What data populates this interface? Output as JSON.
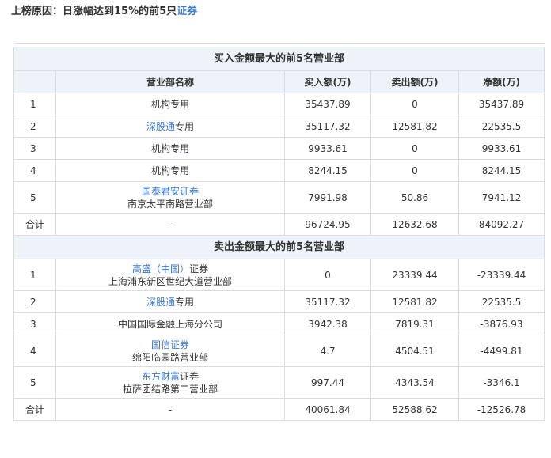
{
  "headline": {
    "prefix": "上榜原因：日涨幅达到15%的前5只",
    "link": "证券"
  },
  "buy_table": {
    "title": "买入金额最大的前5名营业部",
    "headers": [
      "营业部名称",
      "买入额(万)",
      "卖出额(万)",
      "净额(万)"
    ],
    "rows": [
      {
        "idx": "1",
        "link": "",
        "rest": "机构专用",
        "line2": "",
        "buy": "35437.89",
        "sell": "0",
        "net": "35437.89"
      },
      {
        "idx": "2",
        "link": "深股通",
        "rest": "专用",
        "line2": "",
        "buy": "35117.32",
        "sell": "12581.82",
        "net": "22535.5"
      },
      {
        "idx": "3",
        "link": "",
        "rest": "机构专用",
        "line2": "",
        "buy": "9933.61",
        "sell": "0",
        "net": "9933.61"
      },
      {
        "idx": "4",
        "link": "",
        "rest": "机构专用",
        "line2": "",
        "buy": "8244.15",
        "sell": "0",
        "net": "8244.15"
      },
      {
        "idx": "5",
        "link": "国泰君安证券",
        "rest": "",
        "line2": "南京太平南路营业部",
        "buy": "7991.98",
        "sell": "50.86",
        "net": "7941.12"
      }
    ],
    "total": {
      "label": "合计",
      "name": "-",
      "buy": "96724.95",
      "sell": "12632.68",
      "net": "84092.27"
    }
  },
  "sell_table": {
    "title": "卖出金额最大的前5名营业部",
    "rows": [
      {
        "idx": "1",
        "link": "高盛（中国）",
        "rest": "证券",
        "line2": "上海浦东新区世纪大道营业部",
        "buy": "0",
        "sell": "23339.44",
        "net": "-23339.44"
      },
      {
        "idx": "2",
        "link": "深股通",
        "rest": "专用",
        "line2": "",
        "buy": "35117.32",
        "sell": "12581.82",
        "net": "22535.5"
      },
      {
        "idx": "3",
        "link": "",
        "rest": "中国国际金融上海分公司",
        "line2": "",
        "buy": "3942.38",
        "sell": "7819.31",
        "net": "-3876.93"
      },
      {
        "idx": "4",
        "link": "国信证券",
        "rest": "",
        "line2": "绵阳临园路营业部",
        "buy": "4.7",
        "sell": "4504.51",
        "net": "-4499.81"
      },
      {
        "idx": "5",
        "link": "东方财富",
        "rest": "证券",
        "line2": "拉萨团结路第二营业部",
        "buy": "997.44",
        "sell": "4343.54",
        "net": "-3346.1"
      }
    ],
    "total": {
      "label": "合计",
      "name": "-",
      "buy": "40061.84",
      "sell": "52588.62",
      "net": "-12526.78"
    }
  },
  "colors": {
    "link": "#3a7bd5",
    "header_bg": "#eef3f9",
    "border": "#d9dde3",
    "text": "#333333"
  }
}
